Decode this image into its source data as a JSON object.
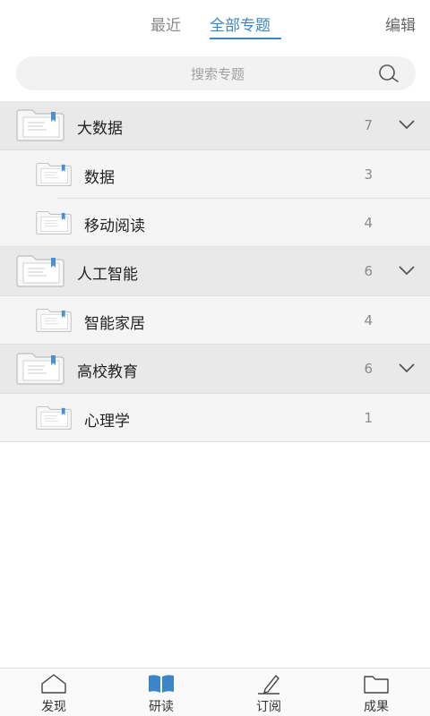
{
  "header": {
    "tabs": [
      {
        "label": "最近"
      },
      {
        "label": "全部专题"
      }
    ],
    "edit_label": "编辑"
  },
  "search": {
    "placeholder": "搜索专题"
  },
  "groups": [
    {
      "label": "大数据",
      "count": "7",
      "items": [
        {
          "label": "数据",
          "count": "3"
        },
        {
          "label": "移动阅读",
          "count": "4"
        }
      ]
    },
    {
      "label": "人工智能",
      "count": "6",
      "items": [
        {
          "label": "智能家居",
          "count": "4"
        }
      ]
    },
    {
      "label": "高校教育",
      "count": "6",
      "items": [
        {
          "label": "心理学",
          "count": "1"
        }
      ]
    }
  ],
  "bottom_nav": [
    {
      "label": "发现",
      "icon": "home-icon"
    },
    {
      "label": "研读",
      "icon": "book-icon",
      "active": true
    },
    {
      "label": "订阅",
      "icon": "pen-icon"
    },
    {
      "label": "成果",
      "icon": "folder-icon"
    }
  ],
  "colors": {
    "accent": "#3a86c9",
    "group_bg": "#e9e9e9",
    "item_bg": "#f5f5f5"
  }
}
